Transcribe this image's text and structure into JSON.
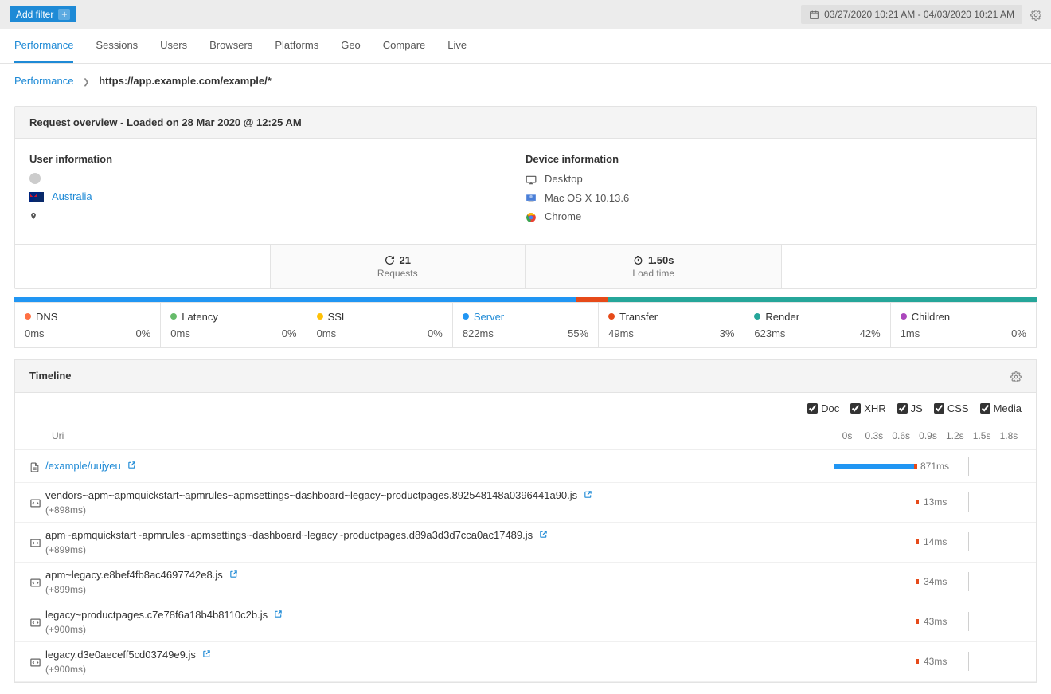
{
  "topbar": {
    "add_filter": "Add filter",
    "date_range": "03/27/2020 10:21 AM - 04/03/2020 10:21 AM"
  },
  "tabs": [
    "Performance",
    "Sessions",
    "Users",
    "Browsers",
    "Platforms",
    "Geo",
    "Compare",
    "Live"
  ],
  "breadcrumb": {
    "root": "Performance",
    "current": "https://app.example.com/example/*"
  },
  "overview": {
    "title": "Request overview - Loaded on 28 Mar 2020 @ 12:25 AM",
    "user_info_title": "User information",
    "country": "Australia",
    "device_info_title": "Device information",
    "device_type": "Desktop",
    "os": "Mac OS X 10.13.6",
    "browser": "Chrome",
    "stats": {
      "requests": "21",
      "requests_label": "Requests",
      "loadtime": "1.50s",
      "loadtime_label": "Load time"
    }
  },
  "metrics": [
    {
      "name": "DNS",
      "color": "#ff7043",
      "value": "0ms",
      "pct": "0%",
      "link": false
    },
    {
      "name": "Latency",
      "color": "#66bb6a",
      "value": "0ms",
      "pct": "0%",
      "link": false
    },
    {
      "name": "SSL",
      "color": "#ffc107",
      "value": "0ms",
      "pct": "0%",
      "link": false
    },
    {
      "name": "Server",
      "color": "#2196f3",
      "value": "822ms",
      "pct": "55%",
      "link": true
    },
    {
      "name": "Transfer",
      "color": "#e64a19",
      "value": "49ms",
      "pct": "3%",
      "link": false
    },
    {
      "name": "Render",
      "color": "#26a69a",
      "value": "623ms",
      "pct": "42%",
      "link": false
    },
    {
      "name": "Children",
      "color": "#ab47bc",
      "value": "1ms",
      "pct": "0%",
      "link": false
    }
  ],
  "timeline": {
    "title": "Timeline",
    "filters": [
      "Doc",
      "XHR",
      "JS",
      "CSS",
      "Media"
    ],
    "uri_header": "Uri",
    "ticks": [
      "0s",
      "0.3s",
      "0.6s",
      "0.9s",
      "1.2s",
      "1.5s",
      "1.8s"
    ],
    "rows": [
      {
        "icon": "doc",
        "uri": "/example/uujyeu",
        "offset": "",
        "ms": "871ms",
        "link": true,
        "bar_start": 0,
        "bar_end": 100
      },
      {
        "icon": "code",
        "uri": "vendors~apm~apmquickstart~apmrules~apmsettings~dashboard~legacy~productpages.892548148a0396441a90.js",
        "offset": "(+898ms)",
        "ms": "13ms",
        "link": false
      },
      {
        "icon": "code",
        "uri": "apm~apmquickstart~apmrules~apmsettings~dashboard~legacy~productpages.d89a3d3d7cca0ac17489.js",
        "offset": "(+899ms)",
        "ms": "14ms",
        "link": false
      },
      {
        "icon": "code",
        "uri": "apm~legacy.e8bef4fb8ac4697742e8.js",
        "offset": "(+899ms)",
        "ms": "34ms",
        "link": false
      },
      {
        "icon": "code",
        "uri": "legacy~productpages.c7e78f6a18b4b8110c2b.js",
        "offset": "(+900ms)",
        "ms": "43ms",
        "link": false
      },
      {
        "icon": "code",
        "uri": "legacy.d3e0aeceff5cd03749e9.js",
        "offset": "(+900ms)",
        "ms": "43ms",
        "link": false
      }
    ]
  }
}
